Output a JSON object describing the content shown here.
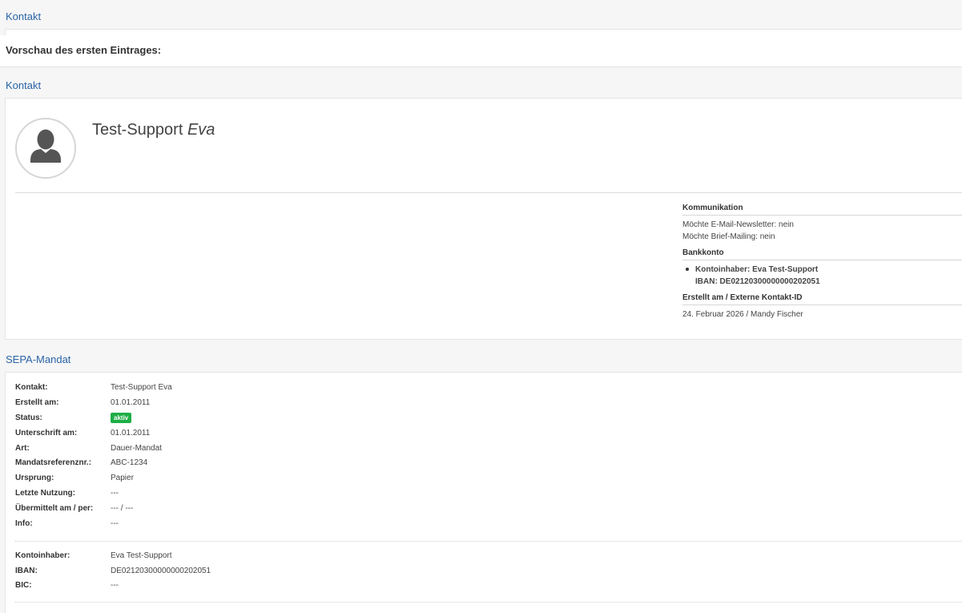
{
  "section1_title": "Kontakt",
  "preview_label": "Vorschau des ersten Eintrages:",
  "section2_title": "Kontakt",
  "contact": {
    "surname": "Test-Support",
    "firstname": "Eva"
  },
  "kommunikation": {
    "head": "Kommunikation",
    "line1": "Möchte E-Mail-Newsletter: nein",
    "line2": "Möchte Brief-Mailing: nein"
  },
  "bankkonto": {
    "head": "Bankkonto",
    "owner": "Kontoinhaber: Eva Test-Support",
    "iban": "IBAN: DE02120300000000202051"
  },
  "erstellt": {
    "head": "Erstellt am / Externe Kontakt-ID",
    "value": "24. Februar 2026 / Mandy Fischer"
  },
  "sepa_title": "SEPA-Mandat",
  "sepa": {
    "kontakt_label": "Kontakt:",
    "kontakt_value": "Test-Support Eva",
    "erstellt_label": "Erstellt am:",
    "erstellt_value": "01.01.2011",
    "status_label": "Status:",
    "status_value": "aktiv",
    "unterschrift_label": "Unterschrift am:",
    "unterschrift_value": "01.01.2011",
    "art_label": "Art:",
    "art_value": "Dauer-Mandat",
    "mandat_label": "Mandatsreferenznr.:",
    "mandat_value": "ABC-1234",
    "ursprung_label": "Ursprung:",
    "ursprung_value": "Papier",
    "nutzung_label": "Letzte Nutzung:",
    "nutzung_value": "---",
    "uebermittelt_label": "Übermittelt am / per:",
    "uebermittelt_value": "--- / ---",
    "info_label": "Info:",
    "info_value": "---",
    "inhaber_label": "Kontoinhaber:",
    "inhaber_value": "Eva Test-Support",
    "iban_label": "IBAN:",
    "iban_value": "DE02120300000000202051",
    "bic_label": "BIC:",
    "bic_value": "---"
  },
  "colors": {
    "link_blue": "#2a64a6",
    "status_green": "#1eae46"
  },
  "icons": {
    "avatar": "person-silhouette-icon"
  }
}
